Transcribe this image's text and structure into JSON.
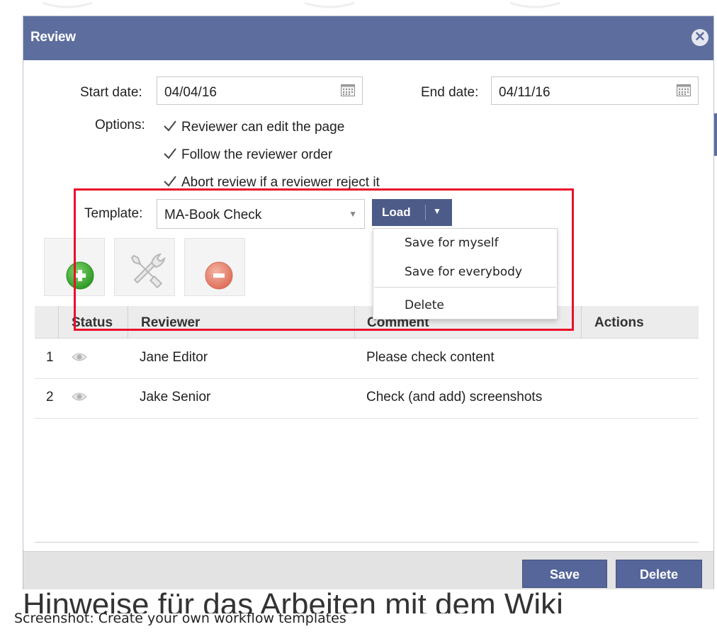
{
  "dialog": {
    "title": "Review",
    "start_date_label": "Start date:",
    "start_date_value": "04/04/16",
    "end_date_label": "End date:",
    "end_date_value": "04/11/16",
    "options_label": "Options:",
    "options": [
      {
        "label": "Reviewer can edit the page",
        "checked": true
      },
      {
        "label": "Follow the reviewer order",
        "checked": true
      },
      {
        "label": "Abort review if a reviewer reject it",
        "checked": true
      }
    ],
    "template_label": "Template:",
    "template_value": "MA-Book Check",
    "load_label": "Load",
    "menu_items": [
      "Save for myself",
      "Save for everybody",
      "Delete"
    ],
    "columns": [
      "Status",
      "Reviewer",
      "Comment",
      "Actions"
    ],
    "rows": [
      {
        "num": "1",
        "reviewer": "Jane Editor",
        "comment": "Please check content"
      },
      {
        "num": "2",
        "reviewer": "Jake Senior",
        "comment": "Check (and add) screenshots"
      }
    ],
    "save_label": "Save",
    "delete_label": "Delete"
  },
  "page": {
    "background_heading": "Hinweise für das Arbeiten mit dem Wiki",
    "caption": "Screenshot: Create your own workflow templates"
  },
  "colors": {
    "title_bar": "#5d6e9e",
    "button": "#56669a",
    "highlight": "#e8102a",
    "add": "#3aa52e",
    "remove": "#e5826e"
  },
  "icons": {
    "close": "close-icon",
    "calendar": "calendar-icon",
    "checkbox": "checkmark-icon",
    "add": "add-icon",
    "edit": "wrench-screwdriver-icon",
    "remove": "remove-icon",
    "status": "eye-icon"
  }
}
